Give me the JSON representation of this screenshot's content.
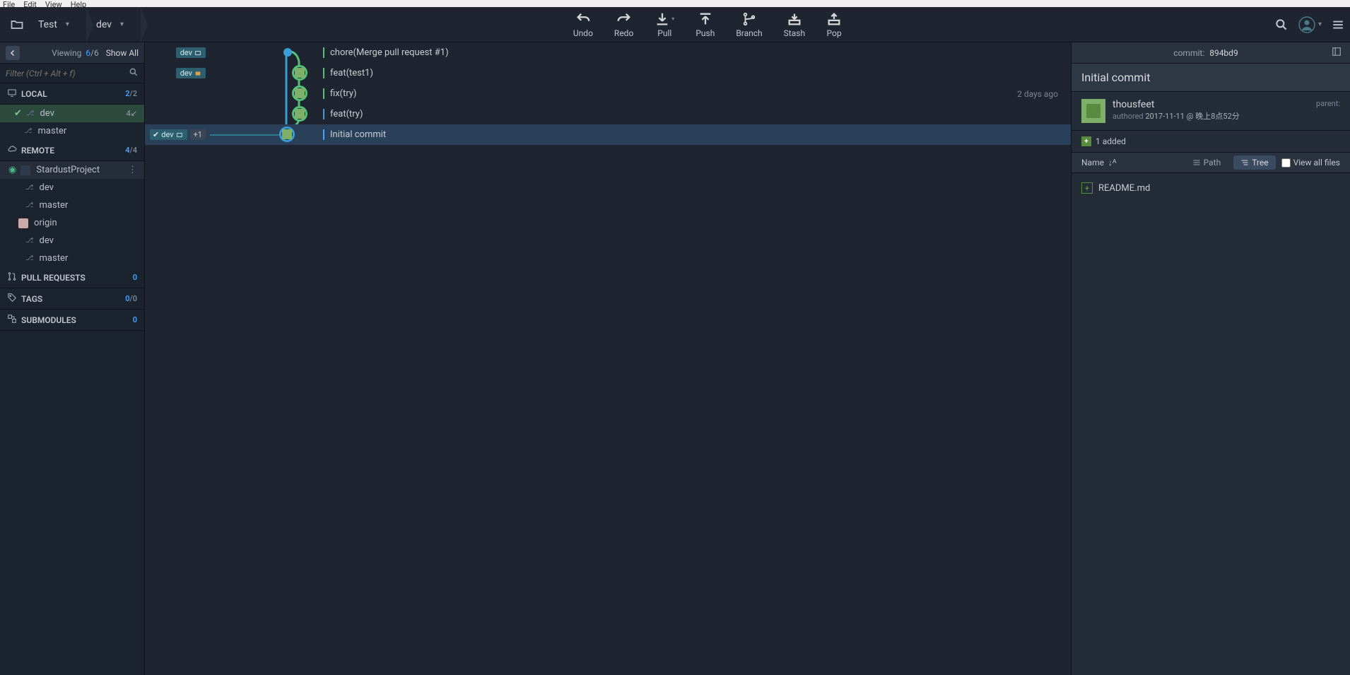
{
  "menubar": [
    "File",
    "Edit",
    "View",
    "Help"
  ],
  "breadcrumb": {
    "repo": "Test",
    "branch": "dev"
  },
  "toolbar": {
    "undo": "Undo",
    "redo": "Redo",
    "pull": "Pull",
    "push": "Push",
    "branch": "Branch",
    "stash": "Stash",
    "pop": "Pop"
  },
  "sidebar": {
    "viewing": "Viewing",
    "viewing_count": "6",
    "viewing_total": "/6",
    "show_all": "Show All",
    "filter_placeholder": "Filter (Ctrl + Alt + f)",
    "local": {
      "label": "LOCAL",
      "count": "2",
      "total": "/2",
      "branches": [
        {
          "name": "dev",
          "badge": "4↙",
          "active": true
        },
        {
          "name": "master",
          "badge": ""
        }
      ]
    },
    "remote": {
      "label": "REMOTE",
      "count": "4",
      "total": "/4",
      "remotes": [
        {
          "name": "StardustProject",
          "branches": [
            "dev",
            "master"
          ],
          "hover": true
        },
        {
          "name": "origin",
          "branches": [
            "dev",
            "master"
          ]
        }
      ]
    },
    "pull_requests": {
      "label": "PULL REQUESTS",
      "count": "0"
    },
    "tags": {
      "label": "TAGS",
      "count": "0",
      "total": "/0"
    },
    "submodules": {
      "label": "SUBMODULES",
      "count": "0"
    }
  },
  "commits": [
    {
      "tag": "dev",
      "msg": "chore(Merge pull request #1)",
      "time": ""
    },
    {
      "tag": "dev",
      "msg": "feat(test1)",
      "time": ""
    },
    {
      "tag": "",
      "msg": "fix(try)",
      "time": "2 days ago"
    },
    {
      "tag": "",
      "msg": "feat(try)",
      "time": ""
    },
    {
      "tag": "dev",
      "tag_check": true,
      "extra": "+1",
      "msg": "Initial commit",
      "time": "",
      "selected": true
    }
  ],
  "detail": {
    "commit_label": "commit:",
    "hash": "894bd9",
    "title": "Initial commit",
    "author": "thousfeet",
    "authored": "authored",
    "date": "2017-11-11 @ 晚上8点52分",
    "parent": "parent:",
    "changes": "1 added",
    "name_label": "Name",
    "path_label": "Path",
    "tree_label": "Tree",
    "view_all": "View all files",
    "files": [
      "README.md"
    ]
  }
}
